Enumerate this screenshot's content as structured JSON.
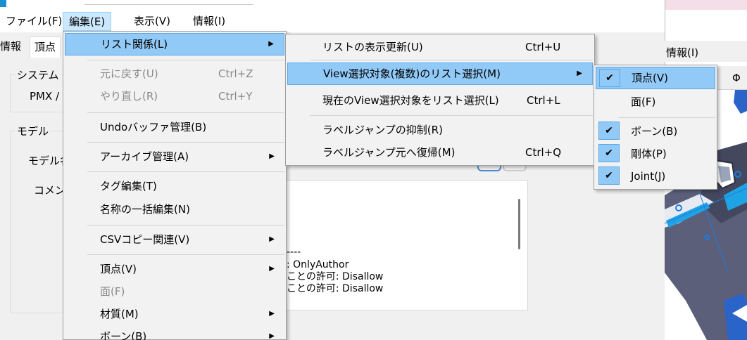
{
  "menubar": {
    "items": [
      "ファイル(F)",
      "編集(E)",
      "表示(V)",
      "情報(I)"
    ]
  },
  "tabs": [
    "情報",
    "頂点"
  ],
  "form": {
    "system_label": "システム",
    "pmx_label": "PMX /",
    "model_label": "モデル",
    "model_name_label": "モデル名",
    "comment_label": "コメン"
  },
  "text_area": {
    "lines": [
      "----",
      ": OnlyAuthor",
      "ことの許可: Disallow",
      "ことの許可: Disallow"
    ]
  },
  "preview": {
    "header": "情報(I)",
    "toolbar_symbol": "Φ"
  },
  "edit_menu": {
    "items": [
      {
        "label": "リスト関係(L)",
        "shortcut": "",
        "submenu": true,
        "disabled": false
      },
      {
        "label": "元に戻す(U)",
        "shortcut": "Ctrl+Z",
        "submenu": false,
        "disabled": true
      },
      {
        "label": "やり直し(R)",
        "shortcut": "Ctrl+Y",
        "submenu": false,
        "disabled": true
      },
      {
        "label": "Undoバッファ管理(B)",
        "shortcut": "",
        "submenu": false,
        "disabled": false
      },
      {
        "label": "アーカイブ管理(A)",
        "shortcut": "",
        "submenu": true,
        "disabled": false
      },
      {
        "label": "タグ編集(T)",
        "shortcut": "",
        "submenu": false,
        "disabled": false
      },
      {
        "label": "名称の一括編集(N)",
        "shortcut": "",
        "submenu": false,
        "disabled": false
      },
      {
        "label": "CSVコピー関連(V)",
        "shortcut": "",
        "submenu": true,
        "disabled": false
      },
      {
        "label": "頂点(V)",
        "shortcut": "",
        "submenu": true,
        "disabled": false
      },
      {
        "label": "面(F)",
        "shortcut": "",
        "submenu": false,
        "disabled": true
      },
      {
        "label": "材質(M)",
        "shortcut": "",
        "submenu": true,
        "disabled": false
      },
      {
        "label": "ボーン(B)",
        "shortcut": "",
        "submenu": true,
        "disabled": false
      }
    ]
  },
  "list_menu": {
    "items": [
      {
        "label": "リストの表示更新(U)",
        "shortcut": "Ctrl+U",
        "submenu": false
      },
      {
        "label": "View選択対象(複数)のリスト選択(M)",
        "shortcut": "",
        "submenu": true
      },
      {
        "label": "現在のView選択対象をリスト選択(L)",
        "shortcut": "Ctrl+L",
        "submenu": false
      },
      {
        "label": "ラベルジャンプの抑制(R)",
        "shortcut": "",
        "submenu": false
      },
      {
        "label": "ラベルジャンプ元へ復帰(M)",
        "shortcut": "Ctrl+Q",
        "submenu": false
      }
    ]
  },
  "view_select_menu": {
    "items": [
      {
        "label": "頂点(V)",
        "checked": true
      },
      {
        "label": "面(F)",
        "checked": false
      },
      {
        "label": "ボーン(B)",
        "checked": true
      },
      {
        "label": "剛体(P)",
        "checked": true
      },
      {
        "label": "Joint(J)",
        "checked": true
      }
    ]
  },
  "icons": {
    "check": "✔",
    "arrow": "▶"
  }
}
